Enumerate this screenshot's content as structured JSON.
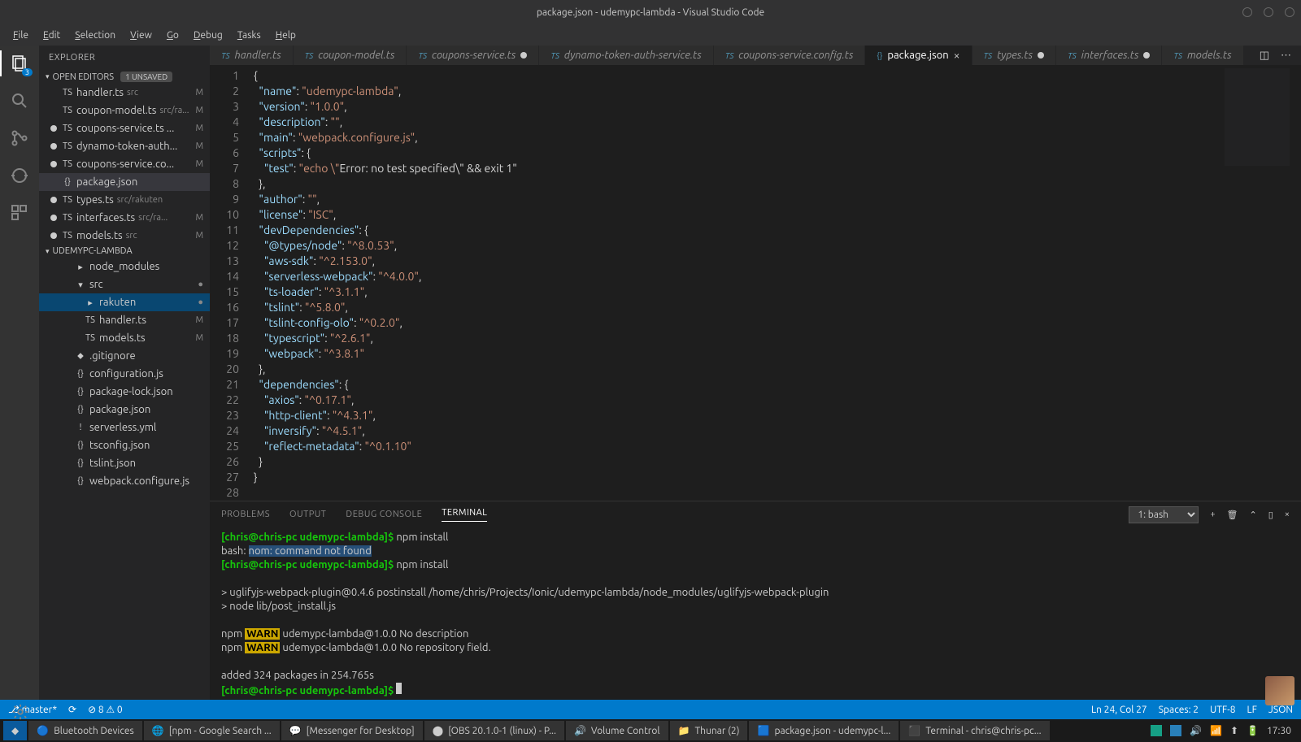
{
  "title": "package.json - udemypc-lambda - Visual Studio Code",
  "menu": [
    "File",
    "Edit",
    "Selection",
    "View",
    "Go",
    "Debug",
    "Tasks",
    "Help"
  ],
  "activity_badge": "3",
  "sidebar": {
    "title": "EXPLORER",
    "open_editors_label": "OPEN EDITORS",
    "unsaved_label": "1 UNSAVED",
    "project_label": "UDEMYPC-LAMBDA",
    "open_editors": [
      {
        "name": "handler.ts",
        "meta": "src",
        "stat": "M"
      },
      {
        "name": "coupon-model.ts",
        "meta": "src/ra...",
        "stat": "M"
      },
      {
        "name": "coupons-service.ts ...",
        "meta": "",
        "stat": "M",
        "dirty": true
      },
      {
        "name": "dynamo-token-auth...",
        "meta": "",
        "stat": "M",
        "dirty": true
      },
      {
        "name": "coupons-service.co...",
        "meta": "",
        "stat": "M",
        "dirty": true
      },
      {
        "name": "package.json",
        "meta": "",
        "stat": "",
        "active": true
      },
      {
        "name": "types.ts",
        "meta": "src/rakuten",
        "stat": "",
        "dirty": true
      },
      {
        "name": "interfaces.ts",
        "meta": "src/ra...",
        "stat": "M",
        "dirty": true
      },
      {
        "name": "models.ts",
        "meta": "src",
        "stat": "M",
        "dirty": true
      }
    ],
    "tree": [
      {
        "label": "node_modules",
        "icon": "▸",
        "indent": 2
      },
      {
        "label": "src",
        "icon": "▾",
        "indent": 2,
        "stat": "●"
      },
      {
        "label": "rakuten",
        "icon": "▸",
        "indent": 3,
        "hl": true,
        "stat": "●"
      },
      {
        "label": "handler.ts",
        "icon": "TS",
        "indent": 3,
        "stat": "M"
      },
      {
        "label": "models.ts",
        "icon": "TS",
        "indent": 3,
        "stat": "M"
      },
      {
        "label": ".gitignore",
        "icon": "⬥",
        "indent": 2
      },
      {
        "label": "configuration.js",
        "icon": "{}",
        "indent": 2
      },
      {
        "label": "package-lock.json",
        "icon": "{}",
        "indent": 2
      },
      {
        "label": "package.json",
        "icon": "{}",
        "indent": 2,
        "sel": false
      },
      {
        "label": "serverless.yml",
        "icon": "!",
        "indent": 2
      },
      {
        "label": "tsconfig.json",
        "icon": "{}",
        "indent": 2
      },
      {
        "label": "tslint.json",
        "icon": "{}",
        "indent": 2
      },
      {
        "label": "webpack.configure.js",
        "icon": "{}",
        "indent": 2
      }
    ]
  },
  "tabs": [
    {
      "label": "handler.ts",
      "icon": "TS"
    },
    {
      "label": "coupon-model.ts",
      "icon": "TS"
    },
    {
      "label": "coupons-service.ts",
      "icon": "TS",
      "mod": true
    },
    {
      "label": "dynamo-token-auth-service.ts",
      "icon": "TS"
    },
    {
      "label": "coupons-service.config.ts",
      "icon": "TS"
    },
    {
      "label": "package.json",
      "icon": "{}",
      "active": true,
      "close": true
    },
    {
      "label": "types.ts",
      "icon": "TS",
      "mod": true
    },
    {
      "label": "interfaces.ts",
      "icon": "TS",
      "mod": true
    },
    {
      "label": "models.ts",
      "icon": "TS"
    }
  ],
  "code_lines": [
    "{",
    "  \"name\": \"udemypc-lambda\",",
    "  \"version\": \"1.0.0\",",
    "  \"description\": \"\",",
    "  \"main\": \"webpack.configure.js\",",
    "  \"scripts\": {",
    "    \"test\": \"echo \\\"Error: no test specified\\\" && exit 1\"",
    "  },",
    "  \"author\": \"\",",
    "  \"license\": \"ISC\",",
    "  \"devDependencies\": {",
    "    \"@types/node\": \"^8.0.53\",",
    "    \"aws-sdk\": \"^2.153.0\",",
    "    \"serverless-webpack\": \"^4.0.0\",",
    "    \"ts-loader\": \"^3.1.1\",",
    "    \"tslint\": \"^5.8.0\",",
    "    \"tslint-config-olo\": \"^0.2.0\",",
    "    \"typescript\": \"^2.6.1\",",
    "    \"webpack\": \"^3.8.1\"",
    "  },",
    "  \"dependencies\": {",
    "    \"axios\": \"^0.17.1\",",
    "    \"http-client\": \"^4.3.1\",",
    "    \"inversify\": \"^4.5.1\",",
    "    \"reflect-metadata\": \"^0.1.10\"",
    "  }",
    "}",
    ""
  ],
  "panel": {
    "tabs": [
      "PROBLEMS",
      "OUTPUT",
      "DEBUG CONSOLE",
      "TERMINAL"
    ],
    "active": "TERMINAL",
    "term_selector": "1: bash"
  },
  "terminal_lines": [
    {
      "t": "prompt",
      "user": "[chris@chris-pc",
      "dir": "udemypc-lambda]$",
      "cmd": " npm install"
    },
    {
      "t": "plain",
      "text": "bash: ",
      "sel": "nom: command not found"
    },
    {
      "t": "prompt",
      "user": "[chris@chris-pc",
      "dir": "udemypc-lambda]$",
      "cmd": " npm install"
    },
    {
      "t": "blank"
    },
    {
      "t": "plain",
      "text": "> uglifyjs-webpack-plugin@0.4.6 postinstall /home/chris/Projects/Ionic/udemypc-lambda/node_modules/uglifyjs-webpack-plugin"
    },
    {
      "t": "plain",
      "text": "> node lib/post_install.js"
    },
    {
      "t": "blank"
    },
    {
      "t": "warn",
      "pre": "npm ",
      "warn": "WARN",
      "post": " udemypc-lambda@1.0.0 No description"
    },
    {
      "t": "warn",
      "pre": "npm ",
      "warn": "WARN",
      "post": " udemypc-lambda@1.0.0 No repository field."
    },
    {
      "t": "blank"
    },
    {
      "t": "plain",
      "text": "added 324 packages in 254.765s"
    },
    {
      "t": "prompt",
      "user": "[chris@chris-pc",
      "dir": "udemypc-lambda]$",
      "cmd": " ",
      "cursor": true
    }
  ],
  "status": {
    "branch": "master*",
    "sync": "⟳",
    "errors": "⊘ 8  ⚠ 0",
    "pos": "Ln 24, Col 27",
    "spaces": "Spaces: 2",
    "enc": "UTF-8",
    "eol": "LF",
    "lang": "JSON"
  },
  "taskbar": {
    "items": [
      {
        "icon": "🔵",
        "label": "Bluetooth Devices"
      },
      {
        "icon": "🌐",
        "label": "[npm - Google Search ..."
      },
      {
        "icon": "💬",
        "label": "[Messenger for Desktop]"
      },
      {
        "icon": "⬤",
        "label": "[OBS 20.1.0-1 (linux) - P..."
      },
      {
        "icon": "🔊",
        "label": "Volume Control"
      },
      {
        "icon": "📁",
        "label": "Thunar (2)"
      },
      {
        "icon": "🟦",
        "label": "package.json - udemypc-l..."
      },
      {
        "icon": "⬛",
        "label": "Terminal - chris@chris-pc..."
      }
    ],
    "time": "17:30"
  }
}
